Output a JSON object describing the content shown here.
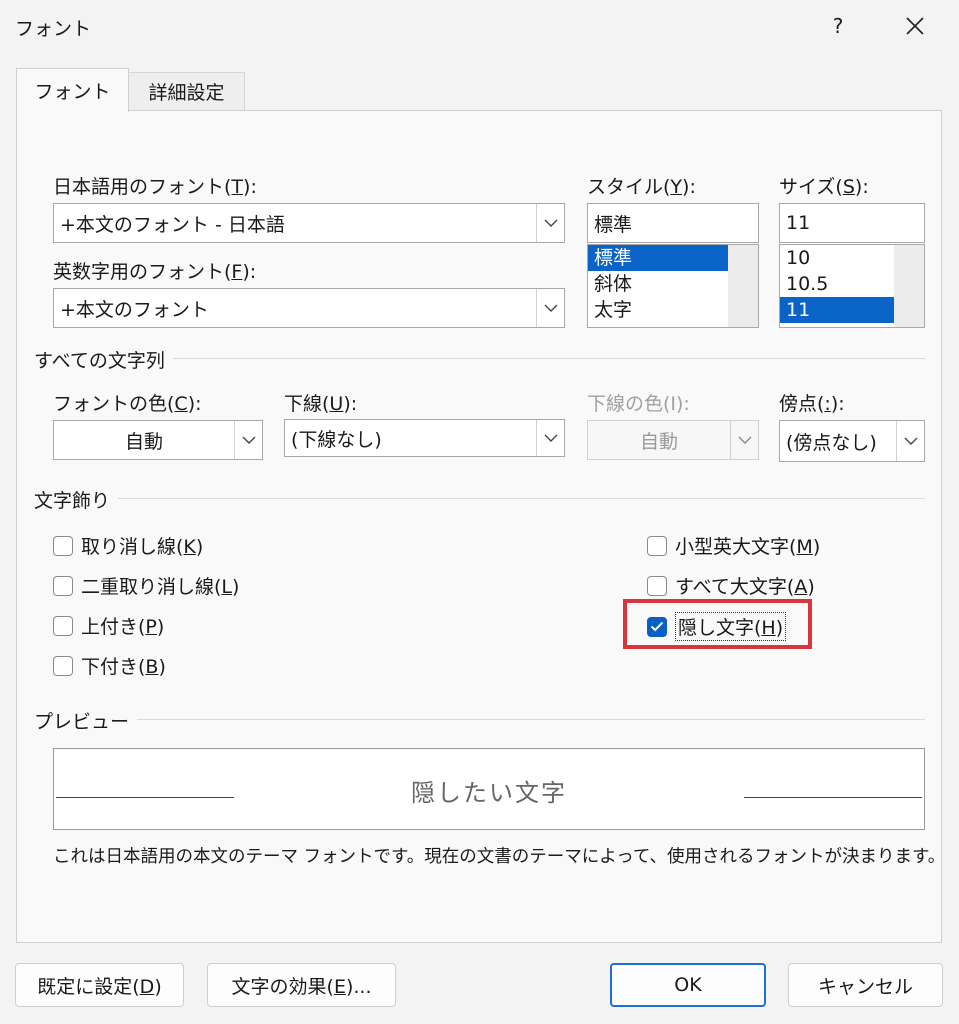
{
  "window": {
    "title": "フォント",
    "help": "?"
  },
  "tabs": [
    {
      "label": "フォント",
      "active": true
    },
    {
      "label": "詳細設定",
      "active": false
    }
  ],
  "fonts": {
    "japanese_label": {
      "text": "日本語用のフォント(",
      "key": "T",
      "end": "):"
    },
    "japanese_value": "+本文のフォント - 日本語",
    "latin_label": {
      "text": "英数字用のフォント(",
      "key": "F",
      "end": "):"
    },
    "latin_value": "+本文のフォント",
    "style_label": {
      "text": "スタイル(",
      "key": "Y",
      "end": "):"
    },
    "style_value": "標準",
    "style_options": [
      "標準",
      "斜体",
      "太字"
    ],
    "style_selected": "標準",
    "size_label": {
      "text": "サイズ(",
      "key": "S",
      "end": "):"
    },
    "size_value": "11",
    "size_options": [
      "10",
      "10.5",
      "11"
    ],
    "size_selected": "11"
  },
  "all_text": {
    "group_title": "すべての文字列",
    "font_color_label": {
      "text": "フォントの色(",
      "key": "C",
      "end": "):"
    },
    "font_color_value": "自動",
    "underline_label": {
      "text": "下線(",
      "key": "U",
      "end": "):"
    },
    "underline_value": "(下線なし)",
    "underline_color_label": "下線の色(I):",
    "underline_color_value": "自動",
    "emphasis_label": {
      "text": "傍点(",
      "key": ":",
      "end": "):"
    },
    "emphasis_value": "(傍点なし)"
  },
  "effects": {
    "group_title": "文字飾り",
    "items": [
      {
        "text": "取り消し線(",
        "key": "K",
        "end": ")",
        "checked": false
      },
      {
        "text": "二重取り消し線(",
        "key": "L",
        "end": ")",
        "checked": false
      },
      {
        "text": "上付き(",
        "key": "P",
        "end": ")",
        "checked": false
      },
      {
        "text": "下付き(",
        "key": "B",
        "end": ")",
        "checked": false
      },
      {
        "text": "小型英大文字(",
        "key": "M",
        "end": ")",
        "checked": false
      },
      {
        "text": "すべて大文字(",
        "key": "A",
        "end": ")",
        "checked": false
      },
      {
        "text": "隠し文字(",
        "key": "H",
        "end": ")",
        "checked": true
      }
    ],
    "highlight_color": "#d8363f"
  },
  "preview": {
    "group_title": "プレビュー",
    "sample_text": "隠したい文字",
    "note": "これは日本語用の本文のテーマ フォントです。現在の文書のテーマによって、使用されるフォントが決まります。"
  },
  "buttons": {
    "set_default": {
      "text": "既定に設定(",
      "key": "D",
      "end": ")"
    },
    "text_effects": {
      "text": "文字の効果(",
      "key": "E",
      "end": ")..."
    },
    "ok": "OK",
    "cancel": "キャンセル"
  },
  "colors": {
    "selection": "#0a64c8",
    "checkbox_checked": "#0a5fc4",
    "primary_button_border": "#1f6fd1"
  }
}
